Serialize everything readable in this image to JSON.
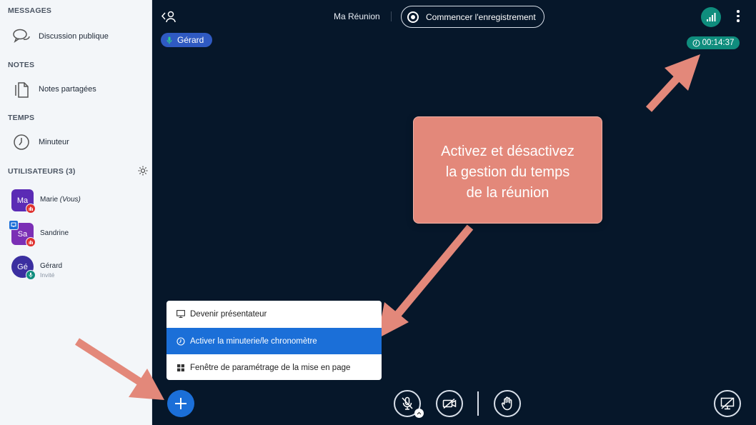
{
  "sidebar": {
    "messages_title": "MESSAGES",
    "public_chat": "Discussion publique",
    "notes_title": "NOTES",
    "shared_notes": "Notes partagées",
    "time_title": "TEMPS",
    "timer": "Minuteur",
    "users_title": "UTILISATEURS (3)",
    "users": [
      {
        "initials": "Ma",
        "name": "Marie",
        "suffix": "(Vous)",
        "role": "",
        "color": "#5b2bb5"
      },
      {
        "initials": "Sa",
        "name": "Sandrine",
        "suffix": "",
        "role": "",
        "color": "#7b2fb5"
      },
      {
        "initials": "Gé",
        "name": "Gérard",
        "suffix": "",
        "role": "Invité",
        "color": "#3b2fa0"
      }
    ]
  },
  "header": {
    "meeting_name": "Ma Réunion",
    "record_label": "Commencer l'enregistrement",
    "talking": "Gérard",
    "elapsed": "00:14:37"
  },
  "callout": {
    "lines": [
      "Activez et désactivez",
      "la gestion du temps",
      "de la réunion"
    ]
  },
  "menu": {
    "items": [
      {
        "label": "Devenir présentateur",
        "icon": "presentation-icon",
        "active": false
      },
      {
        "label": "Activer la minuterie/le chronomètre",
        "icon": "clock-icon",
        "active": true
      },
      {
        "label": "Fenêtre de paramétrage de la mise en page",
        "icon": "layout-icon",
        "active": false
      }
    ]
  },
  "colors": {
    "background": "#06172a",
    "accent": "#1b6fd8",
    "timer": "#0f8d7d",
    "callout": "#e3887a"
  }
}
